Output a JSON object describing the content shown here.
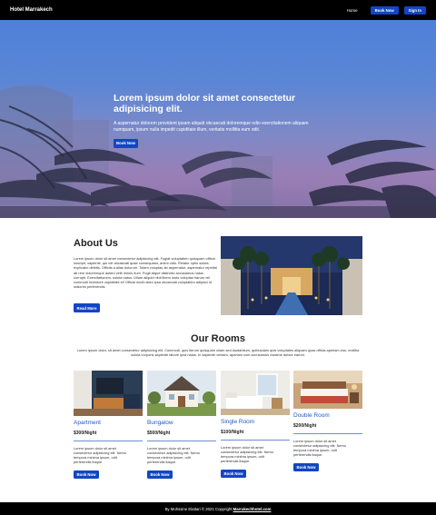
{
  "navbar": {
    "brand": "Hotel Marrakech",
    "home_label": "Home",
    "book_label": "Book Now",
    "signin_label": "Sign In"
  },
  "hero": {
    "title": "Lorem ipsum dolor sit amet consectetur adipisicing elit.",
    "text": "A aspernatur dolorem provident ipsam aliquid obcaecati doloremque odio exercitationem aliquam numquam, ipsum nulla impedit cupiditate illum, veritatis mollitia eum odit.",
    "button_label": "Book Now"
  },
  "about": {
    "title": "About Us",
    "text": "Lorem ipsum dolor sit amet consectetur adipisicing elit. Fugiat voluptatem quisquam officia suscipit, sapiente, qui vel obcaecati quae consequatur, animi odio. Reiatur optio soluta explicabo debitis. Officiis a alias dolorum. Totam voluptas ab aspernatur, aspernatur repellat ab rem doloremque autem velit minus eum. Fugit atque distinctio accusamus natus corrupti. Exercitationem, soluta natus. Ullam aliquid nihil libero iusto voluptas harum vel commodi inventore cupiditate id! Officia modi ullam ipsa obcaecati voluptatem adipisci id maiores perferendis.",
    "button_label": "Read More"
  },
  "rooms": {
    "title": "Our Rooms",
    "text": "Lorem ipsum dolor, sit amet consectetur adipisicing elit. Commodi, quis iterum quisquam ullam sed laudantium, quibusdam quis voluptates aliquam quas officia aperiam eos, mollitia soluta corporis sapiente labore ipsa natus. In sapiente veniam, aperiam cum accusamus maxime dolore earum.",
    "cards": [
      {
        "name": "Apartment",
        "price": "$300/Night",
        "text": "Lorem ipsum dolor sit amet consectetur adipisicing elit. Nemo tempora minima ipsum, odit perferendis itaque.",
        "button_label": "Book Now"
      },
      {
        "name": "Bungalow",
        "price": "$500/Night",
        "text": "Lorem ipsum dolor sit amet consectetur adipisicing elit. Nemo tempora minima ipsum, odit perferendis itaque.",
        "button_label": "Book Now"
      },
      {
        "name": "Single Room",
        "price": "$100/Night",
        "text": "Lorem ipsum dolor sit amet consectetur adipisicing elit. Nemo tempora minima ipsum, odit perferendis itaque.",
        "button_label": "Book Now"
      },
      {
        "name": "Double Room",
        "price": "$200/Night",
        "text": "Lorem ipsum dolor sit amet consectetur adipisicing elit. Nemo tempora minima ipsum, odit perferendis itaque.",
        "button_label": "Book Now"
      }
    ]
  },
  "footer": {
    "text": "By Mohssine Elattari © 2021 Copyright: ",
    "link": "Marrakechhotel.com"
  },
  "colors": {
    "accent": "#1146c4",
    "room_name": "#1d5bc2",
    "hero_sky": "#5a86d6"
  }
}
